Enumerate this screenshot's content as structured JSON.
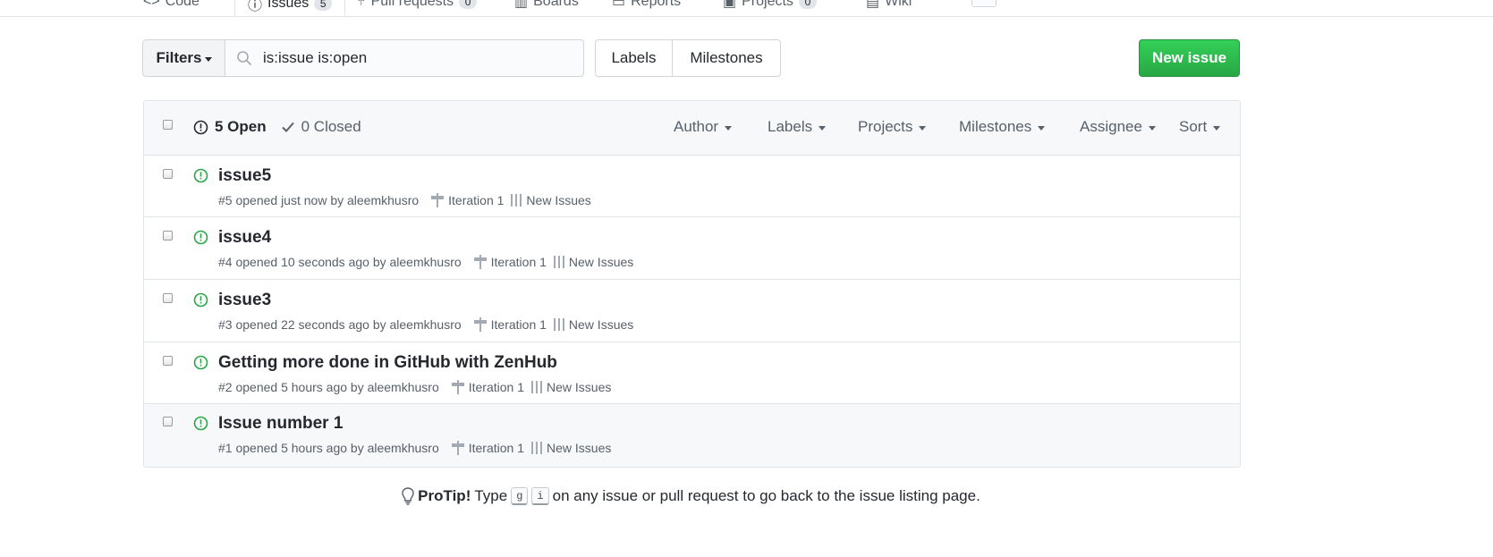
{
  "repo_tabs": [
    {
      "label": "Code",
      "count": ""
    },
    {
      "label": "Issues",
      "count": "5"
    },
    {
      "label": "Pull requests",
      "count": "0"
    },
    {
      "label": "Boards",
      "count": ""
    },
    {
      "label": "Reports",
      "count": ""
    },
    {
      "label": "Projects",
      "count": "0"
    },
    {
      "label": "Wiki",
      "count": ""
    }
  ],
  "toolbar": {
    "filters_label": "Filters",
    "search_value": "is:issue is:open",
    "labels_label": "Labels",
    "milestones_label": "Milestones",
    "new_issue_label": "New issue"
  },
  "list_header": {
    "open_label": "5 Open",
    "closed_label": "0 Closed",
    "filters": [
      "Author",
      "Labels",
      "Projects",
      "Milestones",
      "Assignee",
      "Sort"
    ]
  },
  "issues": [
    {
      "title": "issue5",
      "meta": "#5 opened just now by aleemkhusro",
      "milestone": "Iteration 1",
      "project": "New Issues"
    },
    {
      "title": "issue4",
      "meta": "#4 opened 10 seconds ago by aleemkhusro",
      "milestone": "Iteration 1",
      "project": "New Issues"
    },
    {
      "title": "issue3",
      "meta": "#3 opened 22 seconds ago by aleemkhusro",
      "milestone": "Iteration 1",
      "project": "New Issues"
    },
    {
      "title": "Getting more done in GitHub with ZenHub",
      "meta": "#2 opened 5 hours ago by aleemkhusro",
      "milestone": "Iteration 1",
      "project": "New Issues"
    },
    {
      "title": "Issue number 1",
      "meta": "#1 opened 5 hours ago by aleemkhusro",
      "milestone": "Iteration 1",
      "project": "New Issues"
    }
  ],
  "protip": {
    "label": "ProTip!",
    "text_before": "Type",
    "key_1": "g",
    "key_2": "i",
    "text_after": "on any issue or pull request to go back to the issue listing page."
  },
  "colors": {
    "open_green": "#28a745",
    "tab_accent": "#e36209",
    "button_green": "#2ea44f"
  }
}
